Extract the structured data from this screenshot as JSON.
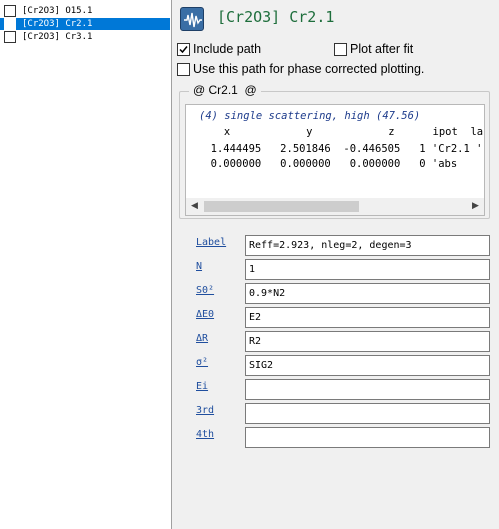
{
  "path_list": [
    {
      "label": "[Cr2O3] O15.1",
      "selected": false
    },
    {
      "label": "[Cr2O3] Cr2.1",
      "selected": true
    },
    {
      "label": "[Cr2O3] Cr3.1",
      "selected": false
    }
  ],
  "header": {
    "icon": "waveform-icon",
    "title": "[Cr2O3] Cr2.1"
  },
  "options": {
    "include_path": {
      "label": "Include path",
      "checked": true
    },
    "plot_after_fit": {
      "label": "Plot after fit",
      "checked": false
    },
    "phase_corrected": {
      "label": "Use this path for phase corrected plotting.",
      "checked": false
    }
  },
  "feff_group": {
    "legend": "@ Cr2.1  @",
    "comment": "(4) single scattering, high (47.56)",
    "header_row": "      x            y            z      ipot  label",
    "rows": [
      "  1.444495   2.501846  -0.446505   1 'Cr2.1 '",
      "  0.000000   0.000000   0.000000   0 'abs   "
    ]
  },
  "params": [
    {
      "label": "Label",
      "value": "Reff=2.923, nleg=2, degen=3"
    },
    {
      "label": "N",
      "value": "1"
    },
    {
      "label": "S0²",
      "value": "0.9*N2"
    },
    {
      "label": "ΔE0",
      "value": "E2"
    },
    {
      "label": "ΔR",
      "value": "R2"
    },
    {
      "label": "σ²",
      "value": "SIG2"
    },
    {
      "label": "Ei",
      "value": ""
    },
    {
      "label": "3rd",
      "value": ""
    },
    {
      "label": "4th",
      "value": ""
    }
  ],
  "colors": {
    "selection": "#0078d7",
    "title_green": "#1e6e3c",
    "link_blue": "#1f4e9e"
  }
}
